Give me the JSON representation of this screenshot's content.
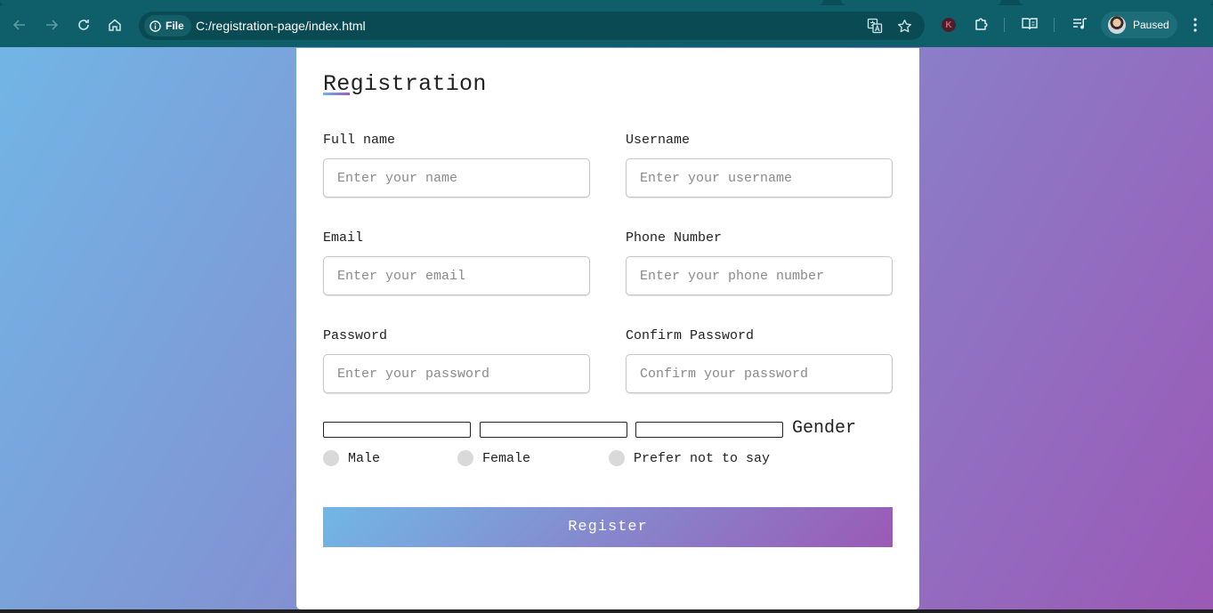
{
  "browser": {
    "site_chip_label": "File",
    "url": "C:/registration-page/index.html",
    "extension_badge": "K",
    "profile_status": "Paused",
    "colors": {
      "toolbar": "#0f5f6a",
      "omnibox": "#0a4a53"
    }
  },
  "form": {
    "title": "Registration",
    "fields": [
      {
        "label": "Full name",
        "placeholder": "Enter your name",
        "value": ""
      },
      {
        "label": "Username",
        "placeholder": "Enter your username",
        "value": ""
      },
      {
        "label": "Email",
        "placeholder": "Enter your email",
        "value": ""
      },
      {
        "label": "Phone Number",
        "placeholder": "Enter your phone number",
        "value": ""
      },
      {
        "label": "Password",
        "placeholder": "Enter your password",
        "value": ""
      },
      {
        "label": "Confirm Password",
        "placeholder": "Confirm your password",
        "value": ""
      }
    ],
    "gender": {
      "title": "Gender",
      "options": [
        "Male",
        "Female",
        "Prefer not to say"
      ]
    },
    "submit_label": "Register",
    "colors": {
      "gradient_start": "#71b7e6",
      "gradient_end": "#9b59b6"
    }
  }
}
